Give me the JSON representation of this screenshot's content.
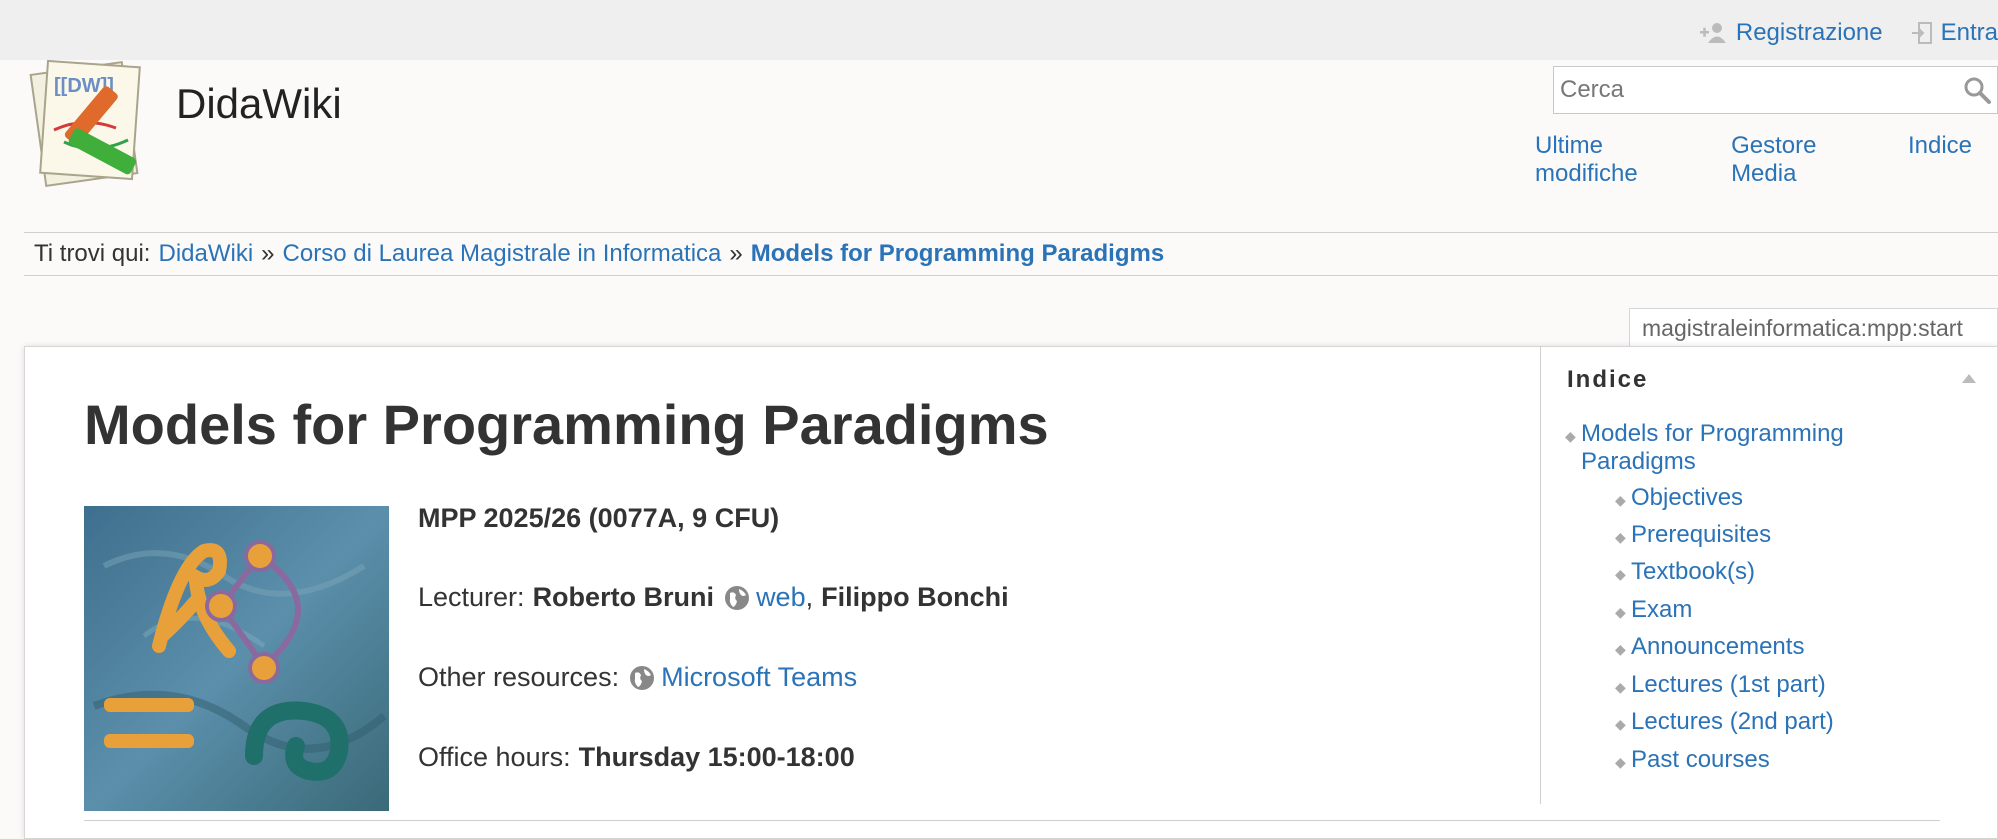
{
  "usertools": {
    "register": "Registrazione",
    "login": "Entra"
  },
  "site": {
    "title": "DidaWiki",
    "logo_text": "[[DW]]"
  },
  "search": {
    "placeholder": "Cerca"
  },
  "sitetools": [
    "Ultime modifiche",
    "Gestore Media",
    "Indice"
  ],
  "breadcrumb": {
    "prefix": "Ti trovi qui:",
    "items": [
      "DidaWiki",
      "Corso di Laurea Magistrale in Informatica",
      "Models for Programming Paradigms"
    ],
    "separator": "»"
  },
  "page_id": "magistraleinformatica:mpp:start",
  "page": {
    "title": "Models for Programming Paradigms",
    "code": "MPP 2025/26 (0077A, 9 CFU)",
    "lecturer_label": "Lecturer:",
    "lecturer1": "Roberto Bruni",
    "lecturer1_link": "web",
    "lecturer_comma": ",",
    "lecturer2": "Filippo Bonchi",
    "resources_label": "Other resources:",
    "resources_link": "Microsoft Teams",
    "office_label": "Office hours:",
    "office_value": "Thursday 15:00-18:00"
  },
  "toc": {
    "header": "Indice",
    "top": "Models for Programming Paradigms",
    "items": [
      "Objectives",
      "Prerequisites",
      "Textbook(s)",
      "Exam",
      "Announcements",
      "Lectures (1st part)",
      "Lectures (2nd part)",
      "Past courses"
    ]
  },
  "colors": {
    "link": "#2b73b7",
    "text": "#333333",
    "background": "#fbfaf9"
  }
}
